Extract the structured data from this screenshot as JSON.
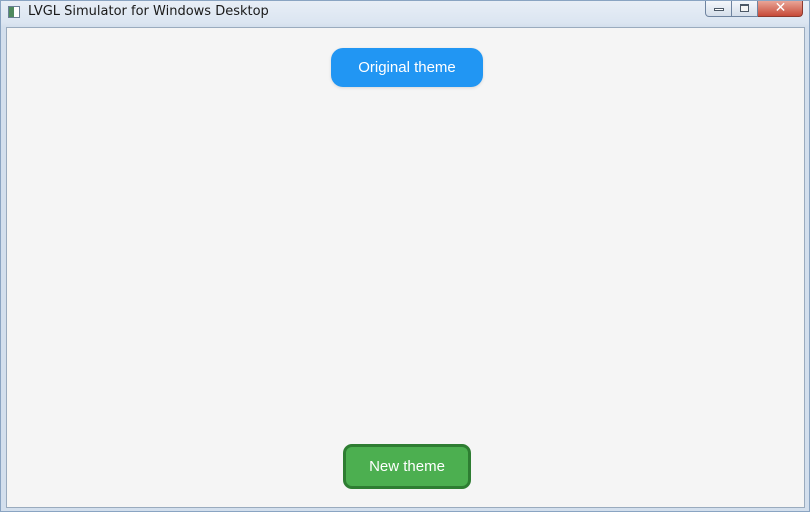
{
  "window": {
    "title": "LVGL Simulator for Windows Desktop",
    "icons": {
      "app": "app-icon",
      "minimize": "minimize-icon",
      "maximize": "maximize-icon",
      "close": "close-icon"
    },
    "close_glyph": "✕"
  },
  "screen": {
    "background": "#f5f5f5",
    "original_theme_button": {
      "label": "Original theme",
      "color": "#2196f3"
    },
    "new_theme_button": {
      "label": "New theme",
      "color": "#4caf50",
      "border_color": "#2e7d32"
    }
  }
}
